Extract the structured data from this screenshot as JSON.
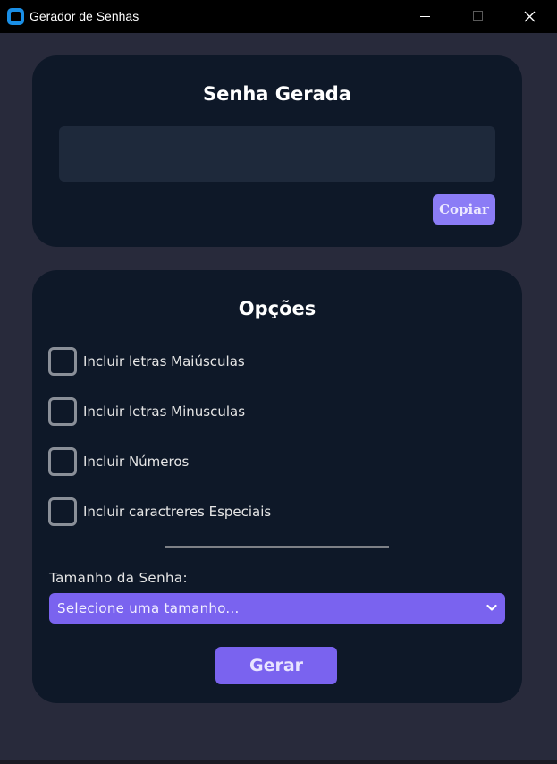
{
  "window": {
    "title": "Gerador de Senhas",
    "icon": "app-icon"
  },
  "password_card": {
    "title": "Senha Gerada",
    "password_value": "",
    "copy_label": "Copiar"
  },
  "options_card": {
    "title": "Opções",
    "options": [
      {
        "label": "Incluir letras Maiúsculas",
        "checked": false
      },
      {
        "label": "Incluir letras Minusculas",
        "checked": false
      },
      {
        "label": "Incluir Números",
        "checked": false
      },
      {
        "label": "Incluir caractreres Especiais",
        "checked": false
      }
    ],
    "size_label": "Tamanho da Senha:",
    "size_select_value": "Selecione uma tamanho...",
    "generate_label": "Gerar"
  },
  "colors": {
    "background": "#282a3b",
    "card": "#0e1828",
    "accent": "#7a63ef",
    "copy_button": "#8b7cf6"
  }
}
